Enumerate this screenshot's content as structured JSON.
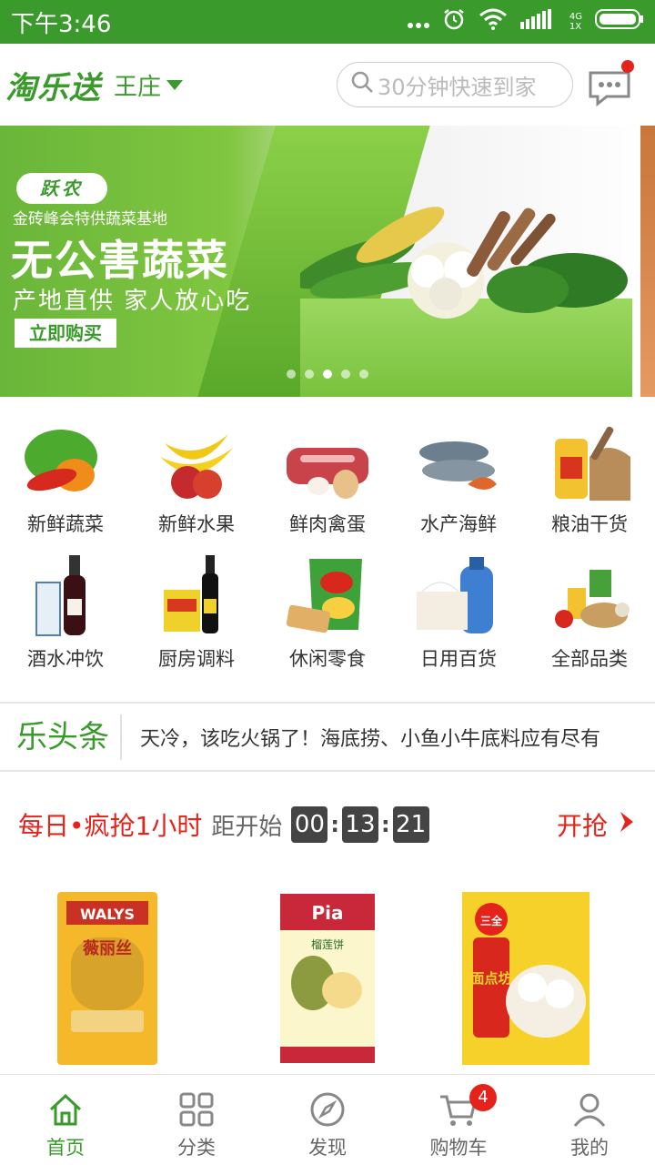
{
  "status_bar": {
    "time": "下午3:46",
    "network_label": "4G",
    "sim_label": "1X"
  },
  "header": {
    "logo": "淘乐送",
    "city": "王庄",
    "search_placeholder": "30分钟快速到家"
  },
  "banner": {
    "brand": "跃农",
    "subtitle": "金砖峰会特供蔬菜基地",
    "title": "无公害蔬菜",
    "slogan": "产地直供  家人放心吃",
    "button": "立即购买",
    "active_dot": 2,
    "dot_count": 5
  },
  "categories": [
    {
      "label": "新鲜蔬菜",
      "icon": "vegetables-icon"
    },
    {
      "label": "新鲜水果",
      "icon": "fruits-icon"
    },
    {
      "label": "鲜肉禽蛋",
      "icon": "meat-eggs-icon"
    },
    {
      "label": "水产海鲜",
      "icon": "seafood-icon"
    },
    {
      "label": "粮油干货",
      "icon": "grain-oil-icon"
    },
    {
      "label": "酒水冲饮",
      "icon": "drinks-icon"
    },
    {
      "label": "厨房调料",
      "icon": "seasoning-icon"
    },
    {
      "label": "休闲零食",
      "icon": "snacks-icon"
    },
    {
      "label": "日用百货",
      "icon": "daily-goods-icon"
    },
    {
      "label": "全部品类",
      "icon": "all-categories-icon"
    }
  ],
  "headlines": {
    "tag": "乐头条",
    "text": "天冷，该吃火锅了！海底捞、小鱼小牛底料应有尽有"
  },
  "flash_sale": {
    "title": "每日•疯抢1小时",
    "countdown_label": "距开始",
    "hours": "00",
    "minutes": "13",
    "seconds": "21",
    "go": "开抢"
  },
  "products": [
    {
      "name": "WALYS",
      "sub": "薇丽丝"
    },
    {
      "name": "Pia",
      "sub": "榴莲饼"
    },
    {
      "name": "三全",
      "sub": "面点坊"
    }
  ],
  "tabbar": {
    "items": [
      {
        "label": "首页",
        "icon": "home-icon",
        "active": true
      },
      {
        "label": "分类",
        "icon": "grid-icon",
        "active": false
      },
      {
        "label": "发现",
        "icon": "compass-icon",
        "active": false
      },
      {
        "label": "购物车",
        "icon": "cart-icon",
        "active": false,
        "badge": "4"
      },
      {
        "label": "我的",
        "icon": "user-icon",
        "active": false
      }
    ]
  },
  "colors": {
    "brand_green": "#3a9a2c",
    "accent_red": "#e5231b"
  }
}
